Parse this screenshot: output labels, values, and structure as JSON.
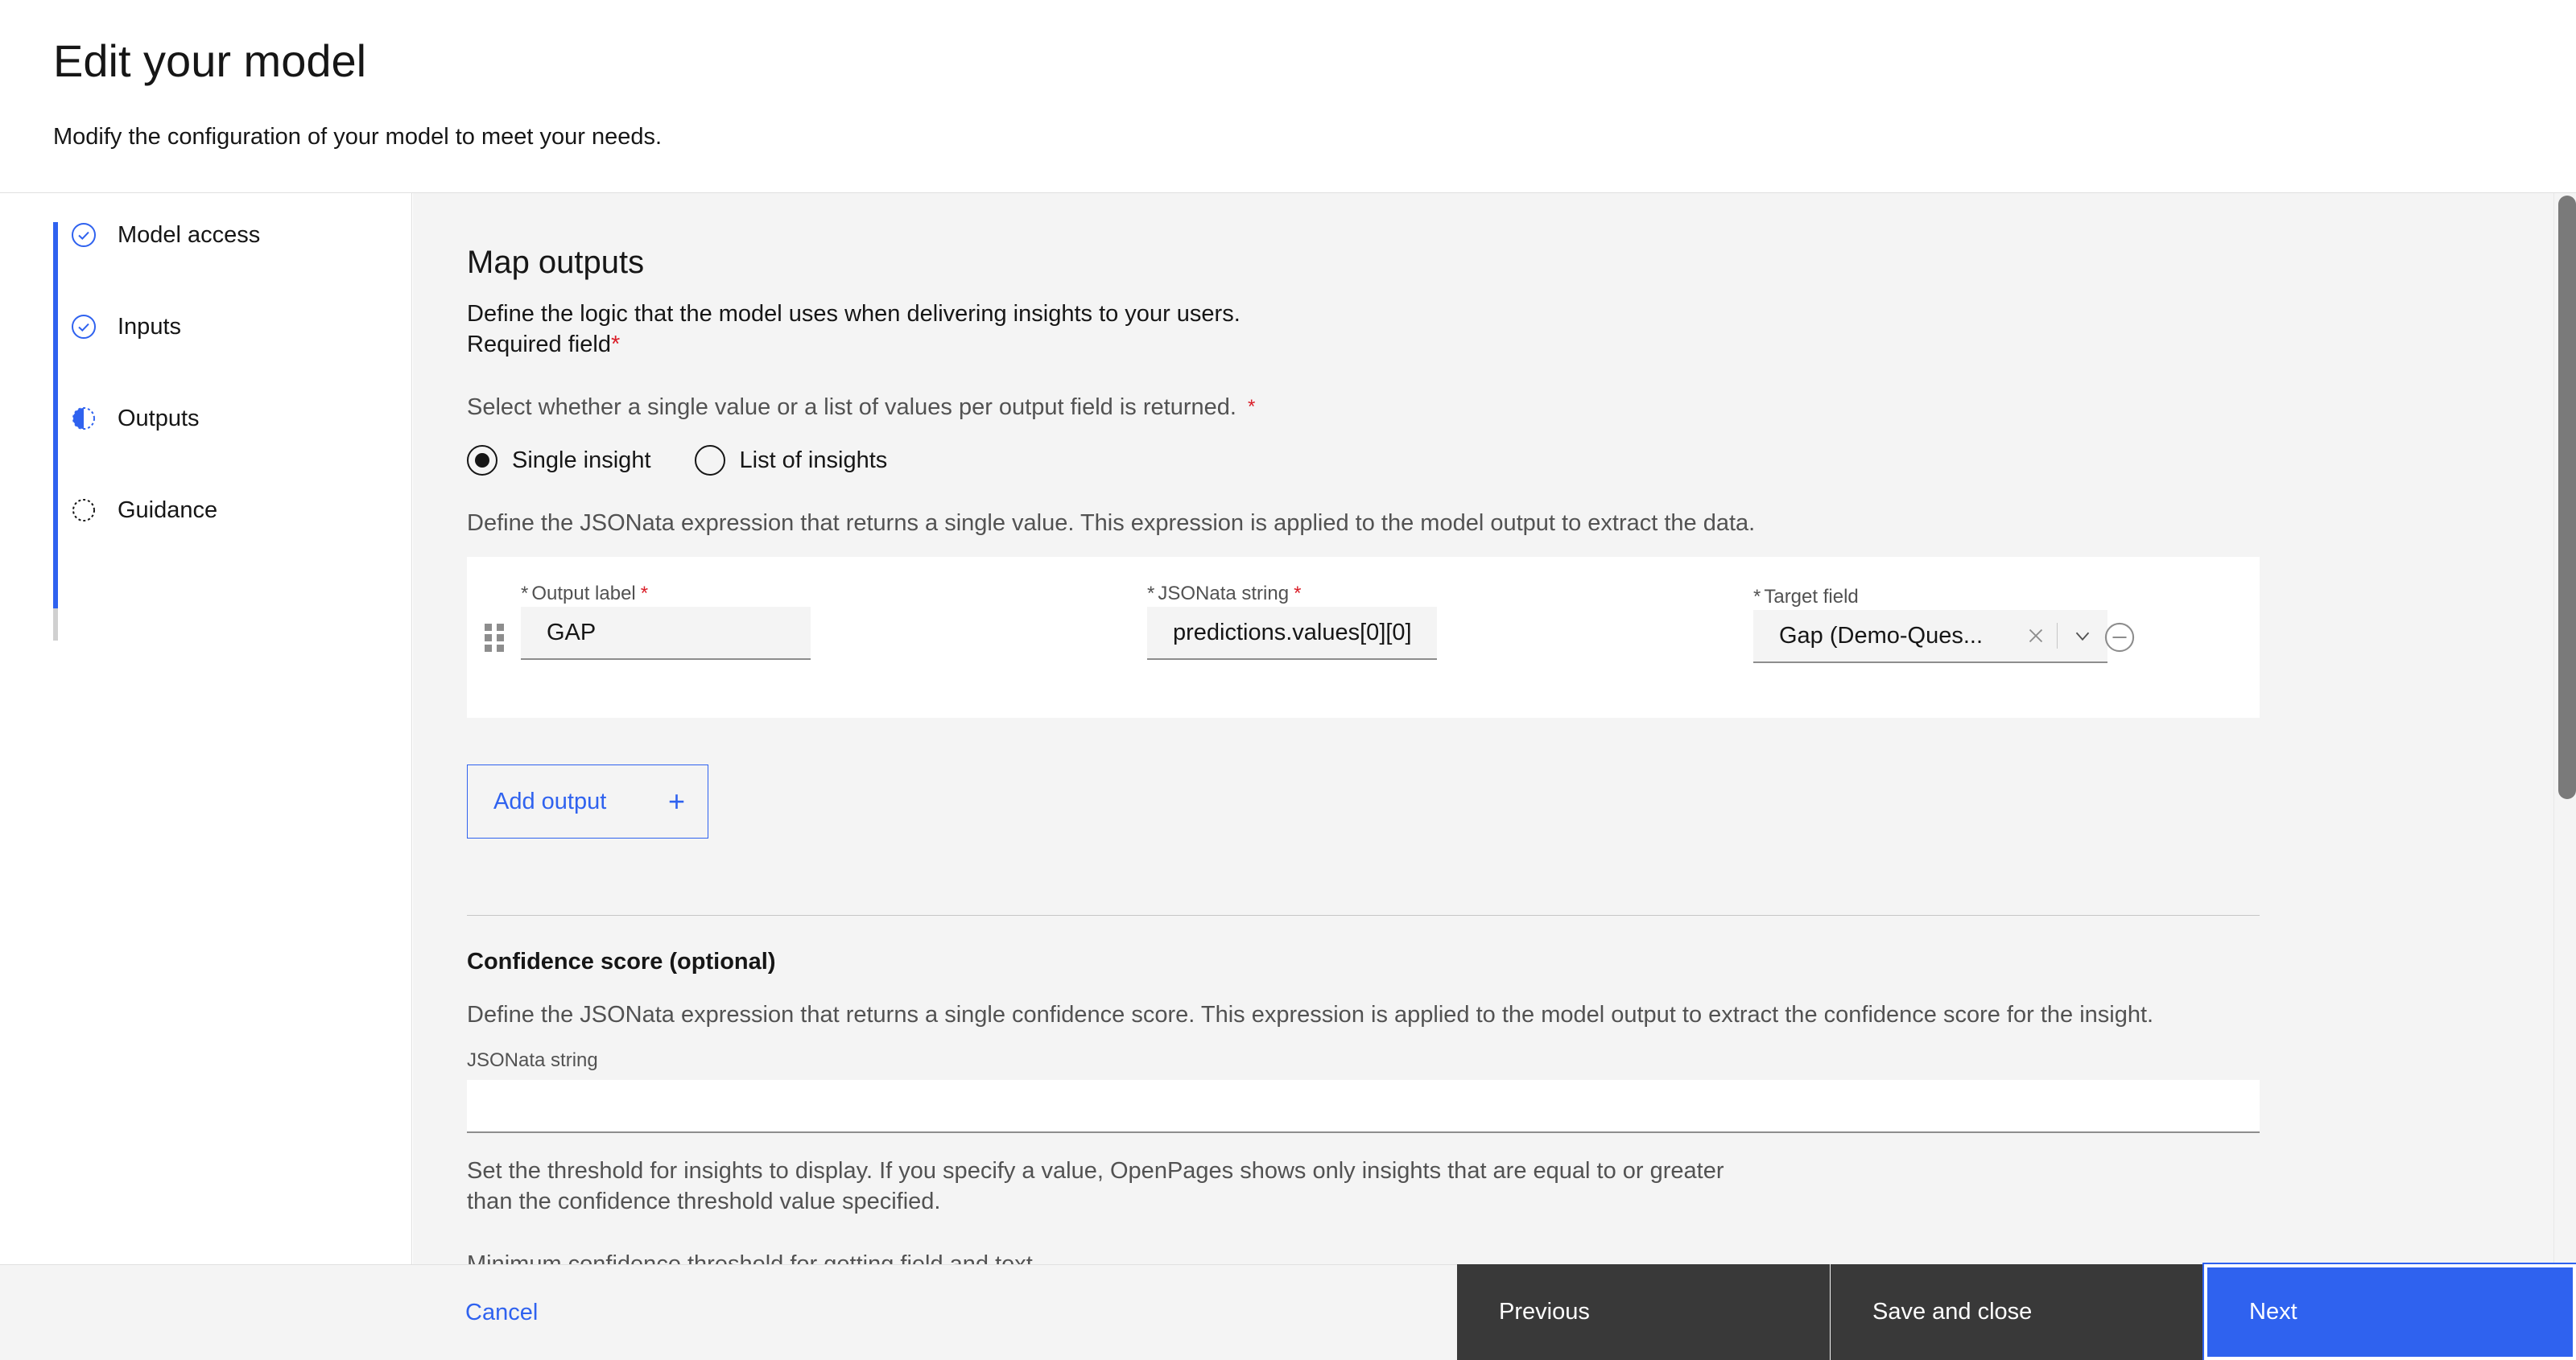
{
  "header": {
    "title": "Edit your model",
    "subtitle": "Modify the configuration of your model to meet your needs."
  },
  "sidebar": {
    "items": [
      {
        "label": "Model access",
        "status": "complete",
        "icon": "check-circle-icon"
      },
      {
        "label": "Inputs",
        "status": "complete",
        "icon": "check-circle-icon"
      },
      {
        "label": "Outputs",
        "status": "current",
        "icon": "half-circle-icon"
      },
      {
        "label": "Guidance",
        "status": "incomplete",
        "icon": "dashed-circle-icon"
      }
    ]
  },
  "main": {
    "section_title": "Map outputs",
    "section_desc": "Define the logic that the model uses when delivering insights to your users.",
    "required_note": "Required field",
    "required_marker": "*",
    "select_desc": "Select whether a single value or a list of values per output field is returned.",
    "radio_options": [
      {
        "label": "Single insight",
        "selected": true
      },
      {
        "label": "List of insights",
        "selected": false
      }
    ],
    "jsonata_desc": "Define the JSONata expression that returns a single value. This expression is applied to the model output to extract the data.",
    "output_row": {
      "output_label_label": "Output label",
      "output_label_value": "GAP",
      "jsonata_label": "JSONata string",
      "jsonata_value": "predictions.values[0][0]",
      "target_field_label": "Target field",
      "target_field_value": "Gap (Demo-Ques...",
      "clear_icon": "close-icon",
      "chevron_icon": "chevron-down-icon",
      "remove_icon": "subtract-circle-icon",
      "drag_icon": "drag-handle-icon"
    },
    "add_output": {
      "label": "Add output",
      "icon": "plus-icon"
    },
    "confidence": {
      "title": "Confidence score (optional)",
      "desc": "Define the JSONata expression that returns a single confidence score. This expression is applied to the model output to extract the confidence score for the insight.",
      "field_label": "JSONata string",
      "field_value": "",
      "field_placeholder": ""
    },
    "threshold_desc_line1": "Set the threshold for insights to display. If you specify a value, OpenPages shows only insights that are equal to or greater",
    "threshold_desc_line2": "than the confidence threshold value specified.",
    "cut_off_text": "Minimum confidence threshold for getting field and text"
  },
  "footer": {
    "cancel": "Cancel",
    "previous": "Previous",
    "save_and_close": "Save and close",
    "next": "Next"
  },
  "colors": {
    "accent_blue": "#2f62ef",
    "required_red": "#da1e28",
    "panel_bg": "#f4f4f4",
    "dark_button": "#393939"
  }
}
